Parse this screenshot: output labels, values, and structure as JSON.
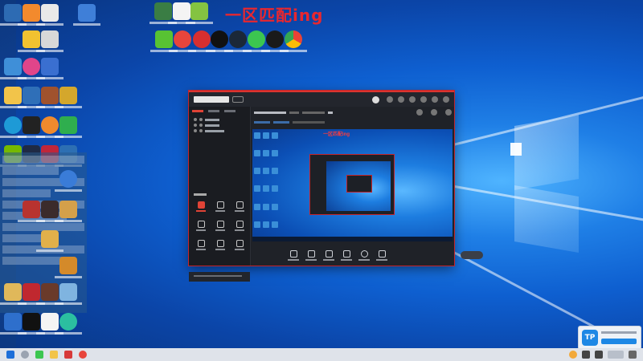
{
  "desktop": {
    "title_text": "一区匹配ing",
    "preview_title_text": "一区匹配ing"
  },
  "popup": {
    "logo_text": "TP"
  },
  "icons": {
    "top_row": [
      "green-app",
      "document",
      "pt-app"
    ],
    "second_row": [
      "iqiyi",
      "netease-music",
      "media-player",
      "steam",
      "wechat",
      "qq",
      "chrome"
    ],
    "left_column": [
      "media-folder",
      "home",
      "file-manager",
      "edge",
      "steam-alt",
      "terminal",
      "discord",
      "chat-app",
      "windows-app",
      "video",
      "calculator",
      "music",
      "cap-cut"
    ]
  },
  "colors": {
    "accent_red": "#e04336",
    "title_red": "#e8272f",
    "desktop_blue": "#0e5fd0",
    "app_bg": "#1d2026"
  }
}
